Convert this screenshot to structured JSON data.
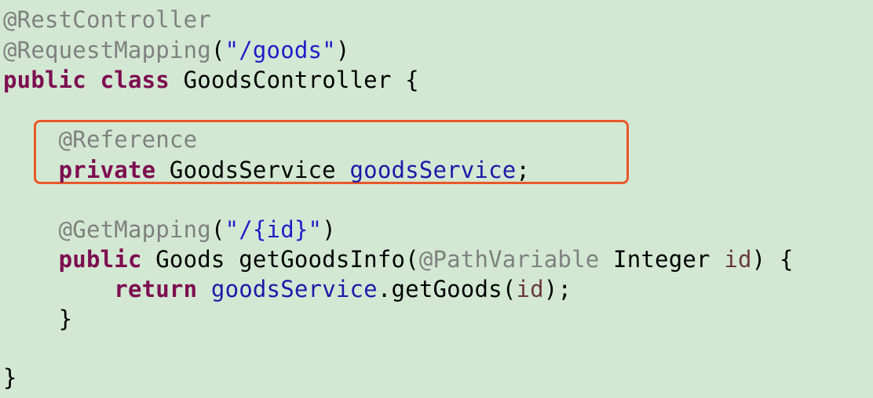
{
  "code": {
    "lines": [
      [
        {
          "t": "@RestController",
          "c": "ann"
        }
      ],
      [
        {
          "t": "@RequestMapping",
          "c": "ann"
        },
        {
          "t": "(",
          "c": "txt"
        },
        {
          "t": "\"/goods\"",
          "c": "str"
        },
        {
          "t": ")",
          "c": "txt"
        }
      ],
      [
        {
          "t": "public",
          "c": "kw"
        },
        {
          "t": " ",
          "c": "txt"
        },
        {
          "t": "class",
          "c": "kw"
        },
        {
          "t": " GoodsController {",
          "c": "txt"
        }
      ],
      [],
      [
        {
          "t": "    ",
          "c": "txt"
        },
        {
          "t": "@Reference",
          "c": "ann"
        }
      ],
      [
        {
          "t": "    ",
          "c": "txt"
        },
        {
          "t": "private",
          "c": "kw"
        },
        {
          "t": " GoodsService ",
          "c": "txt"
        },
        {
          "t": "goodsService",
          "c": "fld"
        },
        {
          "t": ";",
          "c": "txt"
        }
      ],
      [],
      [
        {
          "t": "    ",
          "c": "txt"
        },
        {
          "t": "@GetMapping",
          "c": "ann"
        },
        {
          "t": "(",
          "c": "txt"
        },
        {
          "t": "\"/{id}\"",
          "c": "str"
        },
        {
          "t": ")",
          "c": "txt"
        }
      ],
      [
        {
          "t": "    ",
          "c": "txt"
        },
        {
          "t": "public",
          "c": "kw"
        },
        {
          "t": " Goods getGoodsInfo(",
          "c": "txt"
        },
        {
          "t": "@PathVariable",
          "c": "ann"
        },
        {
          "t": " Integer ",
          "c": "txt"
        },
        {
          "t": "id",
          "c": "par"
        },
        {
          "t": ") {",
          "c": "txt"
        }
      ],
      [
        {
          "t": "        ",
          "c": "txt"
        },
        {
          "t": "return",
          "c": "kw"
        },
        {
          "t": " ",
          "c": "txt"
        },
        {
          "t": "goodsService",
          "c": "fld"
        },
        {
          "t": ".getGoods(",
          "c": "txt"
        },
        {
          "t": "id",
          "c": "par"
        },
        {
          "t": ");",
          "c": "txt"
        }
      ],
      [
        {
          "t": "    }",
          "c": "txt"
        }
      ],
      [],
      [
        {
          "t": "}",
          "c": "txt"
        }
      ]
    ]
  },
  "colors": {
    "background": "#d3e8d3",
    "annotation": "#808080",
    "string": "#1f1ec8",
    "keyword": "#7d0e50",
    "field": "#1a1aa8",
    "parameter": "#6b3a3a",
    "highlight_border": "#e8582a"
  }
}
